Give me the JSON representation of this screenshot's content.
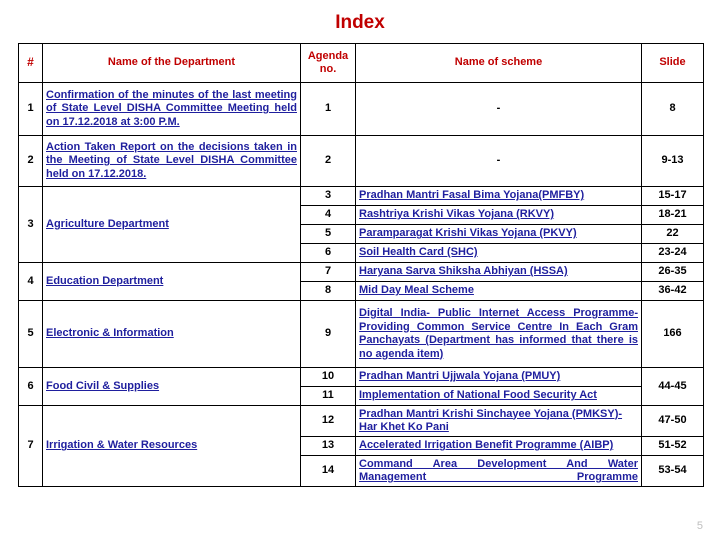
{
  "slide": {
    "title": "Index",
    "page_number": "5",
    "title_color": "#C00000",
    "link_color": "#1F1F9E",
    "border_color": "#000000",
    "background": "#FFFFFF",
    "page_number_color": "#BFBFBF"
  },
  "table": {
    "headers": {
      "num": "#",
      "department": "Name of the Department",
      "agenda": "Agenda no.",
      "scheme": "Name of scheme",
      "slide": "Slide"
    },
    "rows": [
      {
        "num": "1",
        "department": "Confirmation of the minutes of the last meeting   of State Level DISHA Committee Meeting held on 17.12.2018 at 3:00 P.M.",
        "agenda": "1",
        "scheme": "-",
        "slide": "8"
      },
      {
        "num": "2",
        "department": "Action Taken Report on the decisions taken in the Meeting of State Level DISHA Committee held on 17.12.2018.",
        "agenda": "2",
        "scheme": "-",
        "slide": "9-13"
      },
      {
        "num": "3",
        "department": "Agriculture Department",
        "items": [
          {
            "agenda": "3",
            "scheme": "Pradhan Mantri Fasal Bima Yojana(PMFBY)",
            "slide": "15-17"
          },
          {
            "agenda": "4",
            "scheme": "Rashtriya Krishi Vikas Yojana (RKVY)",
            "slide": "18-21"
          },
          {
            "agenda": "5",
            "scheme": "Paramparagat Krishi Vikas Yojana (PKVY)",
            "slide": "22"
          },
          {
            "agenda": "6",
            "scheme": "Soil Health Card (SHC)",
            "slide": "23-24"
          }
        ]
      },
      {
        "num": "4",
        "department": "Education Department",
        "items": [
          {
            "agenda": "7",
            "scheme": "Haryana Sarva Shiksha Abhiyan  (HSSA)",
            "slide": "26-35"
          },
          {
            "agenda": "8",
            "scheme": "Mid Day Meal Scheme",
            "slide": "36-42"
          }
        ]
      },
      {
        "num": "5",
        "department": "Electronic & Information",
        "items": [
          {
            "agenda": "9",
            "scheme": "Digital India- Public Internet Access Programme- Providing Common Service Centre In Each Gram Panchayats (Department has informed that there is no agenda item)",
            "slide": "166"
          }
        ]
      },
      {
        "num": "6",
        "department": "Food Civil & Supplies",
        "items": [
          {
            "agenda": "10",
            "scheme": "Pradhan Mantri Ujjwala Yojana (PMUY)",
            "slide": "44-45"
          },
          {
            "agenda": "11",
            "scheme": "Implementation of  National Food Security Act",
            "slide": ""
          }
        ]
      },
      {
        "num": "7",
        "department": "Irrigation & Water  Resources",
        "items": [
          {
            "agenda": "12",
            "scheme": "Pradhan Mantri Krishi Sinchayee Yojana (PMKSY)-Har Khet Ko Pani",
            "slide": "47-50"
          },
          {
            "agenda": "13",
            "scheme": "Accelerated Irrigation Benefit Programme (AIBP)",
            "slide": "51-52"
          },
          {
            "agenda": "14",
            "scheme": "Command Area Development And Water Management Programme",
            "slide": "53-54"
          }
        ]
      }
    ]
  }
}
